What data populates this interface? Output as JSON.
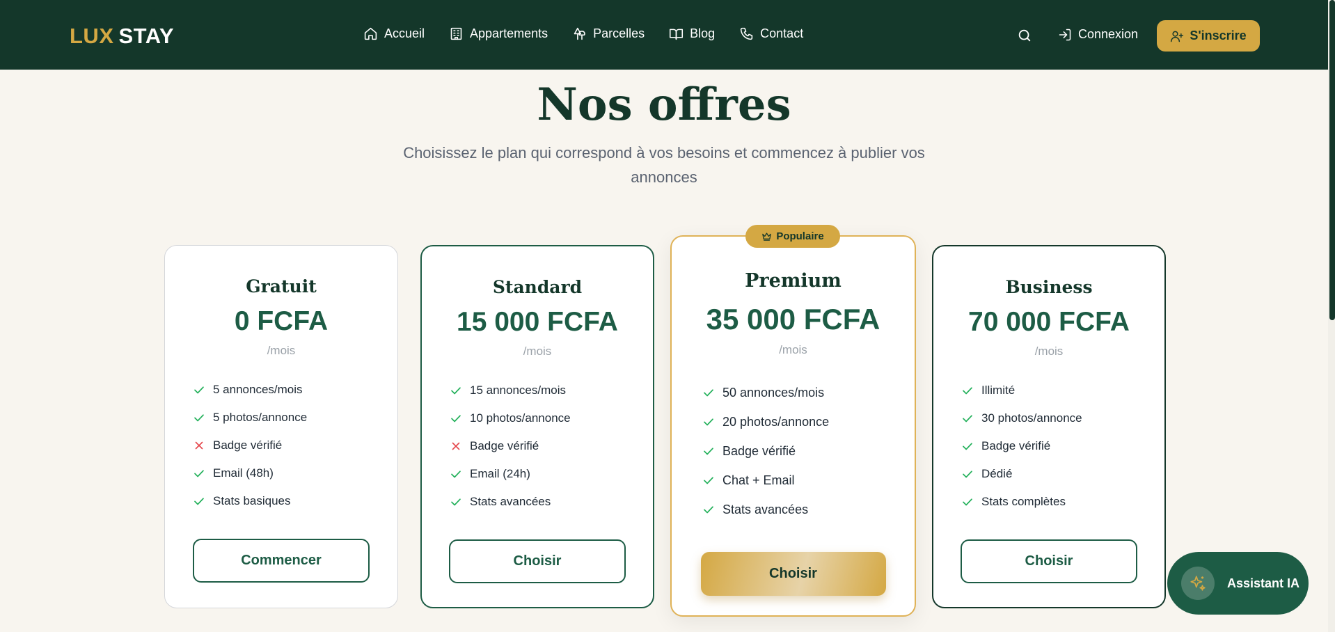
{
  "brand": {
    "logo_part1": "LUX",
    "logo_part2": "STAY"
  },
  "nav": {
    "items": [
      {
        "label": "Accueil",
        "icon": "home-icon"
      },
      {
        "label": "Appartements",
        "icon": "building-icon"
      },
      {
        "label": "Parcelles",
        "icon": "trees-icon"
      },
      {
        "label": "Blog",
        "icon": "book-icon"
      },
      {
        "label": "Contact",
        "icon": "phone-icon"
      }
    ],
    "login_label": "Connexion",
    "signup_label": "S'inscrire"
  },
  "hero": {
    "title": "Nos offres",
    "subtitle": "Choisissez le plan qui correspond à vos besoins et commencez à publier vos annonces"
  },
  "plans": [
    {
      "name": "Gratuit",
      "price": "0 FCFA",
      "period": "/mois",
      "features": [
        {
          "text": "5 annonces/mois",
          "included": true
        },
        {
          "text": "5 photos/annonce",
          "included": true
        },
        {
          "text": "Badge vérifié",
          "included": false
        },
        {
          "text": "Email (48h)",
          "included": true
        },
        {
          "text": "Stats basiques",
          "included": true
        }
      ],
      "button": "Commencer"
    },
    {
      "name": "Standard",
      "price": "15 000 FCFA",
      "period": "/mois",
      "features": [
        {
          "text": "15 annonces/mois",
          "included": true
        },
        {
          "text": "10 photos/annonce",
          "included": true
        },
        {
          "text": "Badge vérifié",
          "included": false
        },
        {
          "text": "Email (24h)",
          "included": true
        },
        {
          "text": "Stats avancées",
          "included": true
        }
      ],
      "button": "Choisir"
    },
    {
      "name": "Premium",
      "price": "35 000 FCFA",
      "period": "/mois",
      "badge": "Populaire",
      "features": [
        {
          "text": "50 annonces/mois",
          "included": true
        },
        {
          "text": "20 photos/annonce",
          "included": true
        },
        {
          "text": "Badge vérifié",
          "included": true
        },
        {
          "text": "Chat + Email",
          "included": true
        },
        {
          "text": "Stats avancées",
          "included": true
        }
      ],
      "button": "Choisir"
    },
    {
      "name": "Business",
      "price": "70 000 FCFA",
      "period": "/mois",
      "features": [
        {
          "text": "Illimité",
          "included": true
        },
        {
          "text": "30 photos/annonce",
          "included": true
        },
        {
          "text": "Badge vérifié",
          "included": true
        },
        {
          "text": "Dédié",
          "included": true
        },
        {
          "text": "Stats complètes",
          "included": true
        }
      ],
      "button": "Choisir"
    }
  ],
  "assistant": {
    "label": "Assistant IA",
    "icon": "sparkles-icon"
  },
  "colors": {
    "primary_dark": "#14372a",
    "primary": "#1d5c45",
    "accent_gold": "#d4a843",
    "check_green": "#22b05a",
    "cross_red": "#e5484d",
    "background": "#f8f5ef"
  }
}
